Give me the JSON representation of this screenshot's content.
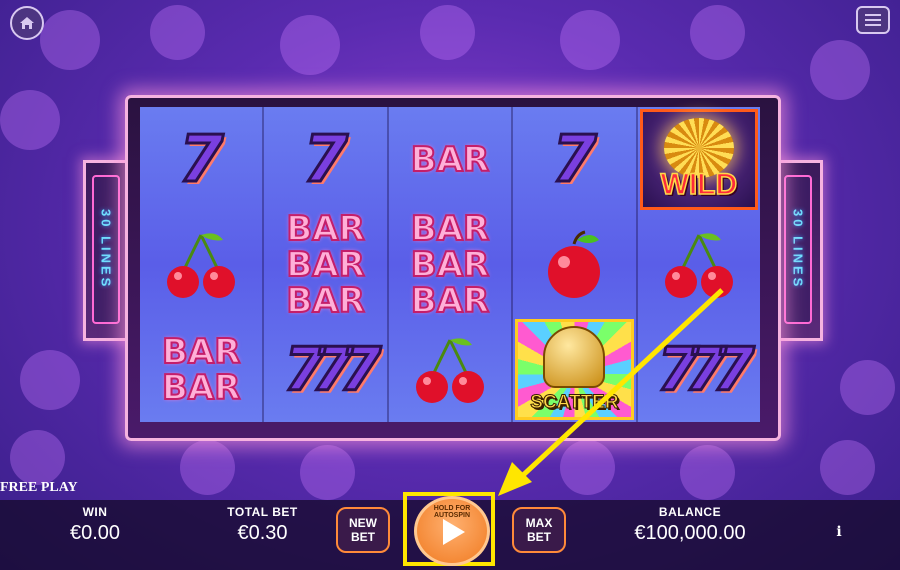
{
  "side_panels": {
    "left_label": "30 LINES",
    "right_label": "30 LINES"
  },
  "reels": [
    [
      "seven",
      "cherry",
      "bar_double"
    ],
    [
      "seven",
      "bar_triple",
      "triple_seven"
    ],
    [
      "bar_single",
      "bar_triple",
      "cherry"
    ],
    [
      "seven",
      "apple",
      "scatter"
    ],
    [
      "wild",
      "cherry",
      "triple_seven"
    ]
  ],
  "symbols": {
    "seven_text": "7",
    "triple_seven_text": "777",
    "bar_text": "BAR",
    "wild_text": "WILD",
    "scatter_text": "SCATTER"
  },
  "bottom": {
    "free_play": "FREE PLAY",
    "win_label": "WIN",
    "win_value": "€0.00",
    "total_bet_label": "TOTAL BET",
    "total_bet_value": "€0.30",
    "new_bet_line1": "NEW",
    "new_bet_line2": "BET",
    "spin_hint": "HOLD FOR AUTOSPIN",
    "max_bet_line1": "MAX",
    "max_bet_line2": "BET",
    "balance_label": "BALANCE",
    "balance_value": "€100,000.00",
    "info_label": "i"
  },
  "icons": {
    "home": "home-icon",
    "menu": "hamburger-menu-icon",
    "info": "info-icon",
    "play": "play-icon"
  },
  "colors": {
    "highlight": "#ffe600",
    "accent": "#ff8a3a",
    "frame_glow": "#f6b3e0"
  }
}
